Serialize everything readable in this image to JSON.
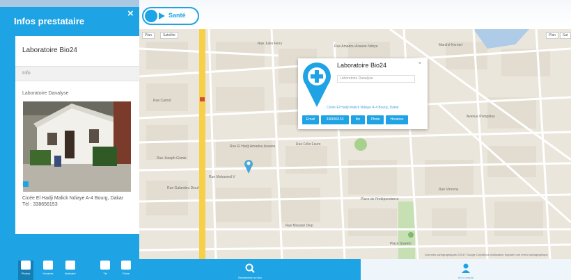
{
  "sidebar": {
    "title": "Infos prestataire",
    "close_label": "×",
    "name": "Laboratoire Bio24",
    "section": "Info",
    "category": "Laboratoire Danalyse",
    "address_line1": "Cicée El Hadji Malick Ndiaye A-4 Bourg, Dakar",
    "address_line2": "Tél : 338656153",
    "icons": [
      {
        "label": "Photos",
        "icon": "image-icon",
        "active": true
      },
      {
        "label": "Horaires",
        "icon": "calendar-icon",
        "active": false
      },
      {
        "label": "Itinéraire",
        "icon": "directions-icon",
        "active": false
      },
      {
        "label": "Tél",
        "icon": "phone-icon",
        "active": false
      },
      {
        "label": "Fiche",
        "icon": "card-icon",
        "active": false
      }
    ]
  },
  "map": {
    "category_button": "Santé",
    "maptype_map": "Plan",
    "maptype_satellite": "Satellite",
    "top_right_small": "Plan",
    "top_right_small2": "Sat",
    "street_labels": [
      "Rue Jules Ferry",
      "Rue Amadou Assane Ndoye",
      "Rue Carnot",
      "Rue El Hadji Amadou Assane",
      "Rue Félix Faure",
      "Rue Joseph Gomis",
      "Rue Mohamed V",
      "Rue Galandou Diouf",
      "Place de l'Indépendance",
      "Avenue Pompidou",
      "Rue Moussé Diop",
      "Rue Vincens",
      "Place Soweto",
      "Marché Kermel"
    ],
    "attribution": "Données cartographiques ©2017 Google   Conditions d'utilisation   Signaler une erreur cartographique"
  },
  "infowindow": {
    "title": "Laboratoire Bio24",
    "subtitle": "Laboratoire Danalyse",
    "close": "×",
    "address": "Cicée El Hadji Malick Ndiaye A-4 Bourg, Dakar",
    "buttons": [
      "Email",
      "338656153",
      "Itin",
      "Photo",
      "Horaires"
    ]
  },
  "bottombar": {
    "search_label": "Rechercher un lieu",
    "other_label": "Mon compte"
  },
  "colors": {
    "accent": "#1ea3e4",
    "map_bg": "#ebe6dc",
    "road_major": "#f7d04a",
    "park": "#c6e0b3"
  }
}
